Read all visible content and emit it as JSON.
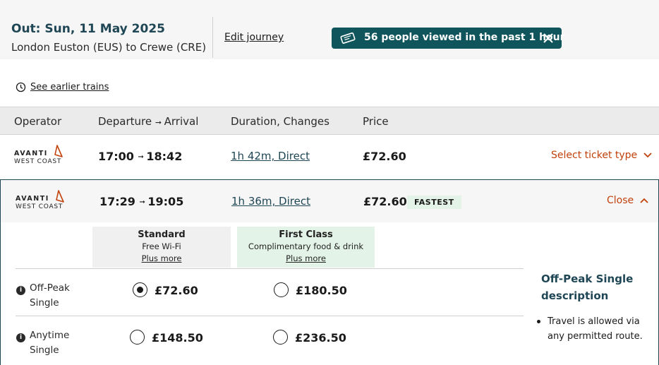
{
  "header": {
    "out_title": "Out: Sun, 11 May 2025",
    "route": "London Euston (EUS) to Crewe (CRE)",
    "edit_journey": "Edit journey",
    "views_badge": "56 people viewed in the past 1 hour"
  },
  "earlier_trains": "See earlier trains",
  "table_header": {
    "operator": "Operator",
    "departure": "Departure",
    "arrival": "Arrival",
    "duration": "Duration, Changes",
    "price": "Price"
  },
  "operator_logo": {
    "line1": "AVANTI",
    "line2": "WEST COAST"
  },
  "rows": [
    {
      "depart": "17:00",
      "arrive": "18:42",
      "duration": "1h 42m, Direct",
      "price": "£72.60",
      "action": "Select ticket type"
    },
    {
      "depart": "17:29",
      "arrive": "19:05",
      "duration": "1h 36m, Direct",
      "price": "£72.60",
      "badge": "FASTEST",
      "action": "Close"
    }
  ],
  "classes": [
    {
      "title": "Standard",
      "sub": "Free Wi-Fi",
      "more": "Plus more",
      "bg": "#f0f0f0"
    },
    {
      "title": "First Class",
      "sub": "Complimentary food & drink",
      "more": "Plus more",
      "bg": "#e3f3e8"
    }
  ],
  "fares": [
    {
      "label_line1": "Off-Peak",
      "label_line2": "Single",
      "standard": "£72.60",
      "first": "£180.50",
      "selected": "standard"
    },
    {
      "label_line1": "Anytime",
      "label_line2": "Single",
      "standard": "£148.50",
      "first": "£236.50",
      "selected": "none"
    }
  ],
  "description": {
    "title_line1": "Off-Peak Single",
    "title_line2": "description",
    "bullet": "Travel is allowed via any permitted route."
  },
  "colors": {
    "brand_teal": "#10555c",
    "link_orange": "#c1410b",
    "heading_blue": "#1f4654",
    "fastest_bg": "#e3f3e8"
  }
}
